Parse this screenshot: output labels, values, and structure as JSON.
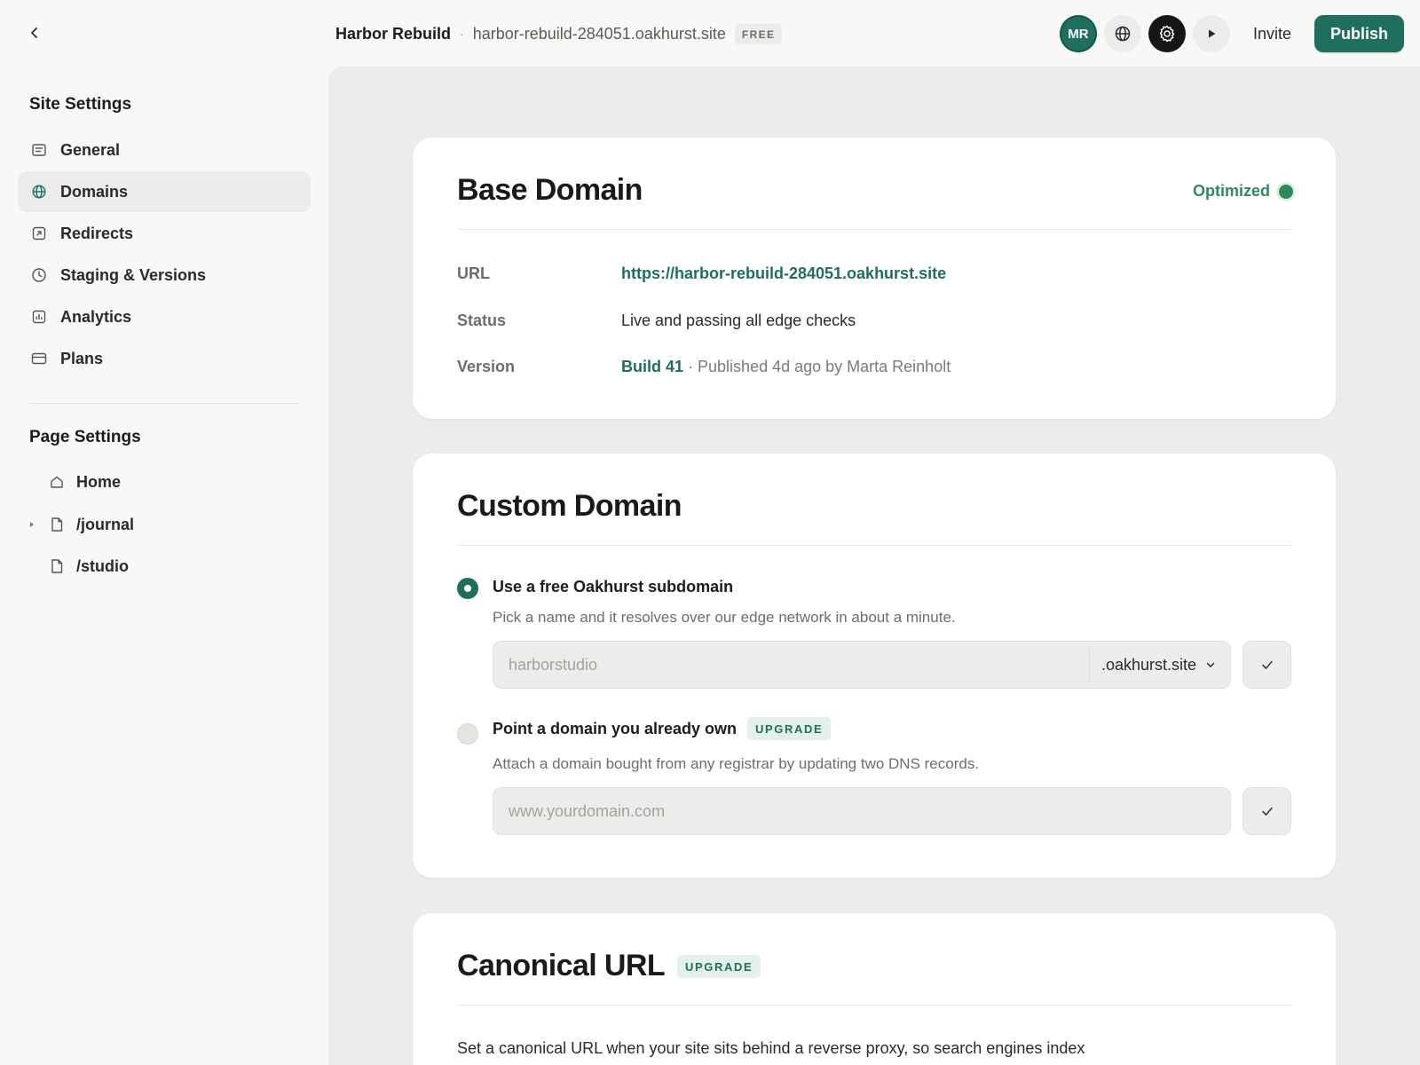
{
  "header": {
    "site_name": "Harbor Rebuild",
    "separator": "·",
    "site_domain": "harbor-rebuild-284051.oakhurst.site",
    "plan_badge": "FREE",
    "avatar_initials": "MR",
    "invite_label": "Invite",
    "publish_label": "Publish",
    "icons": [
      "chevron-left-icon",
      "globe-icon",
      "gear-icon",
      "play-icon"
    ]
  },
  "sidebar": {
    "site_settings_title": "Site Settings",
    "items": [
      {
        "label": "General",
        "icon": "document-icon"
      },
      {
        "label": "Domains",
        "icon": "globe-icon",
        "active": true
      },
      {
        "label": "Redirects",
        "icon": "redirect-icon"
      },
      {
        "label": "Staging & Versions",
        "icon": "clock-icon"
      },
      {
        "label": "Analytics",
        "icon": "analytics-icon"
      },
      {
        "label": "Plans",
        "icon": "card-icon"
      }
    ],
    "page_settings_title": "Page Settings",
    "pages": [
      {
        "label": "Home",
        "icon": "home-icon"
      },
      {
        "label": "/journal",
        "icon": "page-icon",
        "expandable": true
      },
      {
        "label": "/studio",
        "icon": "page-icon"
      }
    ]
  },
  "base_domain": {
    "title": "Base Domain",
    "status_label": "Optimized",
    "status_color": "#2e8a5c",
    "rows": {
      "url_label": "URL",
      "url_value": "https://harbor-rebuild-284051.oakhurst.site",
      "status_label": "Status",
      "status_value": "Live and passing all edge checks",
      "version_label": "Version",
      "version_build": "Build 41",
      "version_detail": "· Published 4d ago by Marta Reinholt"
    }
  },
  "custom_domain": {
    "title": "Custom Domain",
    "option_free": {
      "label": "Use a free Oakhurst subdomain",
      "description": "Pick a name and it resolves over our edge network in about a minute.",
      "input_placeholder": "harborstudio",
      "suffix_selected": ".oakhurst.site",
      "selected": true
    },
    "option_own": {
      "label": "Point a domain you already own",
      "badge": "UPGRADE",
      "description": "Attach a domain bought from any registrar by updating two DNS records.",
      "input_placeholder": "www.yourdomain.com",
      "selected": false
    }
  },
  "canonical": {
    "title": "Canonical URL",
    "badge": "UPGRADE",
    "description": "Set a canonical URL when your site sits behind a reverse proxy, so search engines index"
  },
  "colors": {
    "accent": "#1f6e5e",
    "success": "#2e8a5c",
    "surface": "#ececea"
  }
}
